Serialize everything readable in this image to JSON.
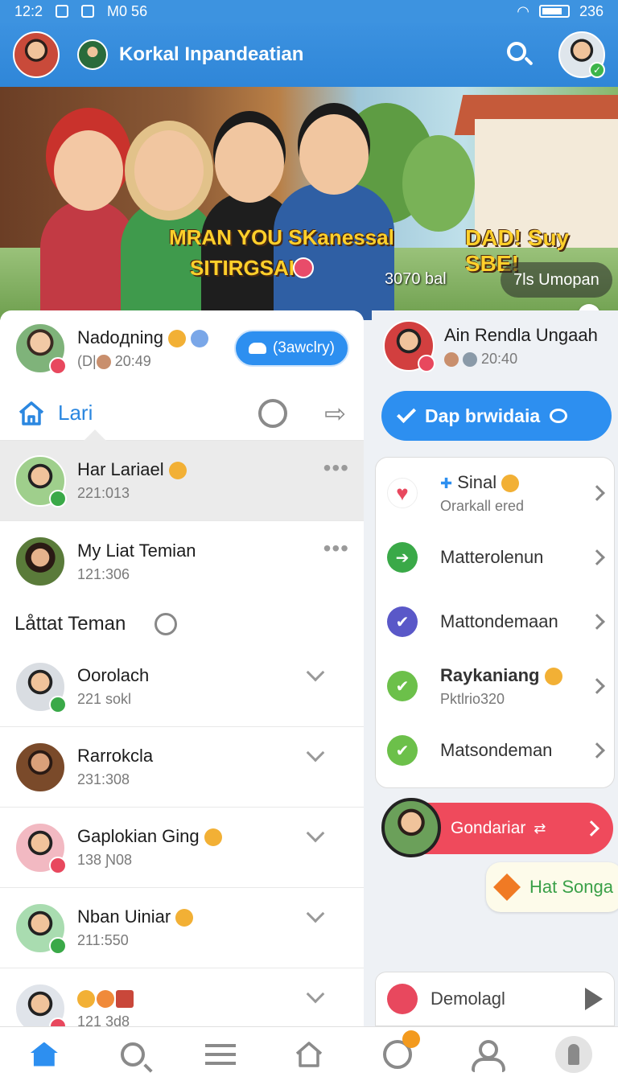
{
  "status_bar": {
    "time": "12:2",
    "carrier": "M0 56",
    "battery": "236"
  },
  "app_bar": {
    "title": "Korkal Inpandeatian"
  },
  "banner": {
    "headline_line1": "MRAN YOU SKanessal",
    "headline_line2": "SITIRGSAI",
    "headline_right": "DAD! Suy SBE!",
    "count": "3070 bal",
    "pill": "7ls Umopan"
  },
  "left_panel": {
    "header": {
      "name": "Nadoдning",
      "sub_prefix": "(D|",
      "time": "20:49",
      "button": "(3awclry)"
    },
    "tab": {
      "label": "Lari"
    },
    "chats": [
      {
        "name": "Har Lariael",
        "sub": "221:013"
      },
      {
        "name": "My Liat Temian",
        "sub": "121:306"
      }
    ],
    "section_title": "Låttat  Teman",
    "contacts": [
      {
        "name": "Oorolach",
        "sub": "221 sokl"
      },
      {
        "name": "Rarrokcla",
        "sub": "231:308"
      },
      {
        "name": "Gaplokian Ging",
        "sub": "138 Ɲ08"
      },
      {
        "name": "Nban Uiniar",
        "sub": "211:550"
      },
      {
        "name": "",
        "sub": "121 3d8"
      }
    ]
  },
  "right_panel": {
    "user": {
      "name": "Ain Rendla Ungaah",
      "time": "20:40"
    },
    "primary_button": "Dap brwidaia",
    "list": [
      {
        "title": "Sinal",
        "sub": "Orarkall ered",
        "icon": "heart-icon",
        "color": "#e8485e"
      },
      {
        "title": "Matterolenun",
        "sub": "",
        "icon": "arrow-icon",
        "color": "#3aa948"
      },
      {
        "title": "Mattondemaan",
        "sub": "",
        "icon": "check-icon",
        "color": "#5a58c8"
      },
      {
        "title": "Raykaniang",
        "sub": "Pktlrio320",
        "icon": "check-icon",
        "color": "#6cc04a"
      },
      {
        "title": "Matsondeman",
        "sub": "",
        "icon": "check-icon",
        "color": "#6cc04a"
      }
    ],
    "red_bar_label": "Gondariar",
    "bubble_label": "Hat Songa",
    "bottom_card_label": "Demolagl"
  },
  "colors": {
    "primary": "#2d8ff0",
    "appbar": "#3c92e0",
    "danger": "#ef4a5c",
    "success": "#3aa948"
  }
}
